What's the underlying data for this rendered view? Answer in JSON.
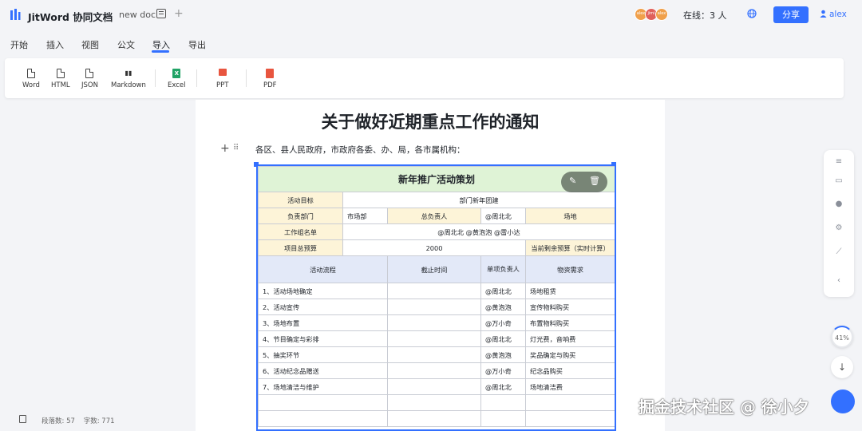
{
  "header": {
    "brand": "JitWord 协同文档",
    "doc_name": "new doc",
    "online": "在线：3 人",
    "share": "分享",
    "user": "alex",
    "avatars": [
      "alex",
      "jimi",
      "alex"
    ]
  },
  "menu": {
    "items": [
      "开始",
      "插入",
      "视图",
      "公文",
      "导入",
      "导出"
    ],
    "active": "导入"
  },
  "toolbar": {
    "items": [
      "Word",
      "HTML",
      "JSON",
      "Markdown",
      "Excel",
      "PPT",
      "PDF"
    ]
  },
  "document": {
    "title": "关于做好近期重点工作的通知",
    "paragraph": "各区、县人民政府，市政府各委、办、局，各市属机构："
  },
  "table": {
    "title": "新年推广活动策划",
    "goal_label": "活动目标",
    "goal_value": "部门新年团建",
    "dept_label": "负责部门",
    "dept_value": "市场部",
    "owner_label": "总负责人",
    "owner_value": "@周北北",
    "venue_label": "场地",
    "group_label": "工作组名单",
    "group_value": "@周北北 @黄泡泡 @雷小达",
    "budget_label": "项目总预算",
    "budget_value": "2000",
    "remain_label": "当前剩余预算（实时计算）",
    "cols": [
      "活动流程",
      "截止时间",
      "单项负责人",
      "物资需求"
    ],
    "rows": [
      [
        "1、活动场地确定",
        "",
        "@周北北",
        "场地租赁"
      ],
      [
        "2、活动宣传",
        "",
        "@黄泡泡",
        "宣传物料购买"
      ],
      [
        "3、场地布置",
        "",
        "@万小奇",
        "布置物料购买"
      ],
      [
        "4、节目确定与彩排",
        "",
        "@周北北",
        "灯光费，音响费"
      ],
      [
        "5、抽奖环节",
        "",
        "@黄泡泡",
        "奖品确定与购买"
      ],
      [
        "6、活动纪念品赠送",
        "",
        "@万小奇",
        "纪念品购买"
      ],
      [
        "7、场地清洁与维护",
        "",
        "@周北北",
        "场地清洁费"
      ],
      [
        "",
        "",
        "",
        ""
      ],
      [
        "",
        "",
        "",
        ""
      ]
    ]
  },
  "zoom": "41%",
  "status": {
    "paragraphs_label": "段落数:",
    "paragraphs": "57",
    "chars_label": "字数:",
    "chars": "771"
  },
  "watermark": "掘金技术社区 @ 徐小夕",
  "colors": {
    "accent": "#3370ff",
    "table_header": "#dff3d6",
    "label_cell": "#fdf4d8",
    "col_header": "#e3e9f8"
  }
}
